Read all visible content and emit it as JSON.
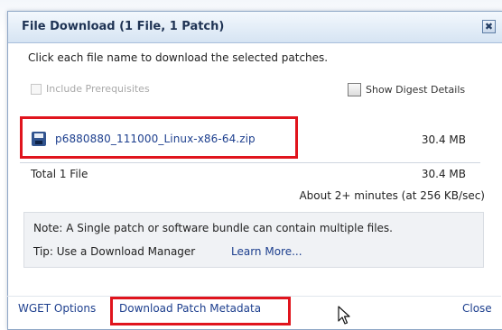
{
  "dialog": {
    "title": "File Download (1 File, 1 Patch)",
    "close_glyph": "✖",
    "instruction": "Click each file name to download the selected patches.",
    "include_prerequisites": {
      "label": "Include Prerequisites",
      "checked": false,
      "enabled": false
    },
    "show_digest_details": {
      "label": "Show Digest Details",
      "checked": false,
      "enabled": true
    },
    "file": {
      "name": "p6880880_111000_Linux-x86-64.zip",
      "size": "30.4 MB",
      "icon": "floppy-disk-icon"
    },
    "total": {
      "label": "Total 1 File",
      "size": "30.4 MB"
    },
    "eta": "About 2+ minutes (at 256 KB/sec)",
    "note": "Note: A Single patch or software bundle can contain multiple files.",
    "tip": "Tip: Use a Download Manager",
    "learn_more": "Learn More...",
    "footer": {
      "wget": "WGET Options",
      "metadata": "Download Patch Metadata",
      "close": "Close"
    }
  },
  "colors": {
    "link": "#1d3f8e",
    "highlight": "#e0141d",
    "titlebar": "#d6e4f3"
  }
}
